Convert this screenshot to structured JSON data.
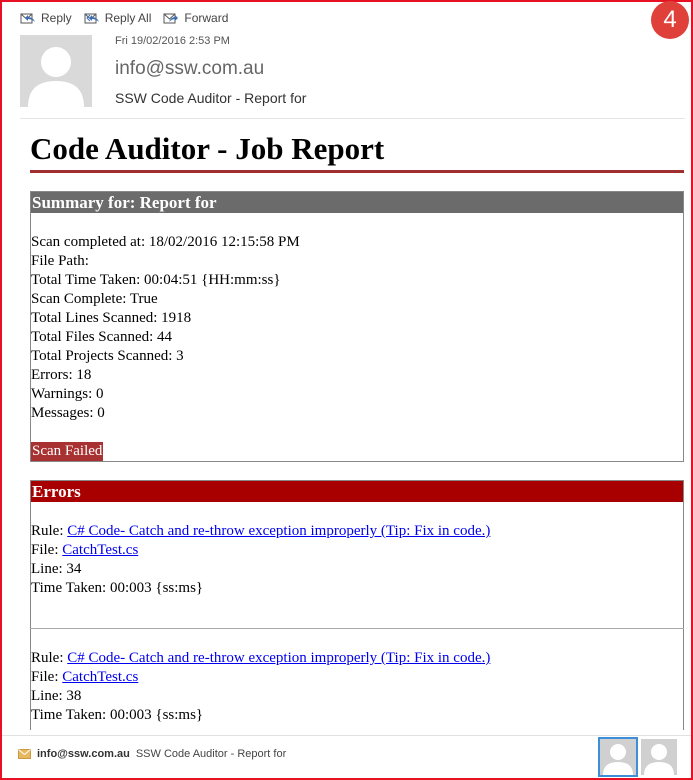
{
  "badge": "4",
  "toolbar": {
    "reply": "Reply",
    "reply_all": "Reply All",
    "forward": "Forward"
  },
  "message": {
    "date": "Fri 19/02/2016 2:53 PM",
    "from": "info@ssw.com.au",
    "subject": "SSW Code Auditor - Report for"
  },
  "report": {
    "title": "Code Auditor - Job Report",
    "summary": {
      "heading": "Summary for: Report for",
      "lines": [
        "Scan completed at: 18/02/2016 12:15:58 PM",
        "File Path:",
        "Total Time Taken: 00:04:51 {HH:mm:ss}",
        "Scan Complete: True",
        "Total Lines Scanned: 1918",
        "Total Files Scanned: 44",
        "Total Projects Scanned: 3",
        "Errors: 18",
        "Warnings: 0",
        "Messages: 0"
      ],
      "status": "Scan Failed",
      "status_color": "#a83232"
    },
    "errors": {
      "heading": "Errors",
      "heading_color": "#a80000",
      "items": [
        {
          "rule_label": "Rule:",
          "rule": "C# Code- Catch and re-throw exception improperly (Tip: Fix in code.)",
          "file_label": "File:",
          "file": "CatchTest.cs",
          "line": "Line: 34",
          "time": "Time Taken: 00:003 {ss:ms}"
        },
        {
          "rule_label": "Rule:",
          "rule": "C# Code- Catch and re-throw exception improperly (Tip: Fix in code.)",
          "file_label": "File:",
          "file": "CatchTest.cs",
          "line": "Line: 38",
          "time": "Time Taken: 00:003 {ss:ms}"
        }
      ]
    }
  },
  "footer": {
    "from": "info@ssw.com.au",
    "subject": "SSW Code Auditor - Report for"
  },
  "colors": {
    "frame": "#e81123",
    "title_rule": "#a03030",
    "summary_head": "#6b6b6b",
    "link": "#0000ee"
  },
  "icons": [
    "reply-icon",
    "reply-all-icon",
    "forward-icon",
    "avatar-icon",
    "envelope-icon"
  ]
}
